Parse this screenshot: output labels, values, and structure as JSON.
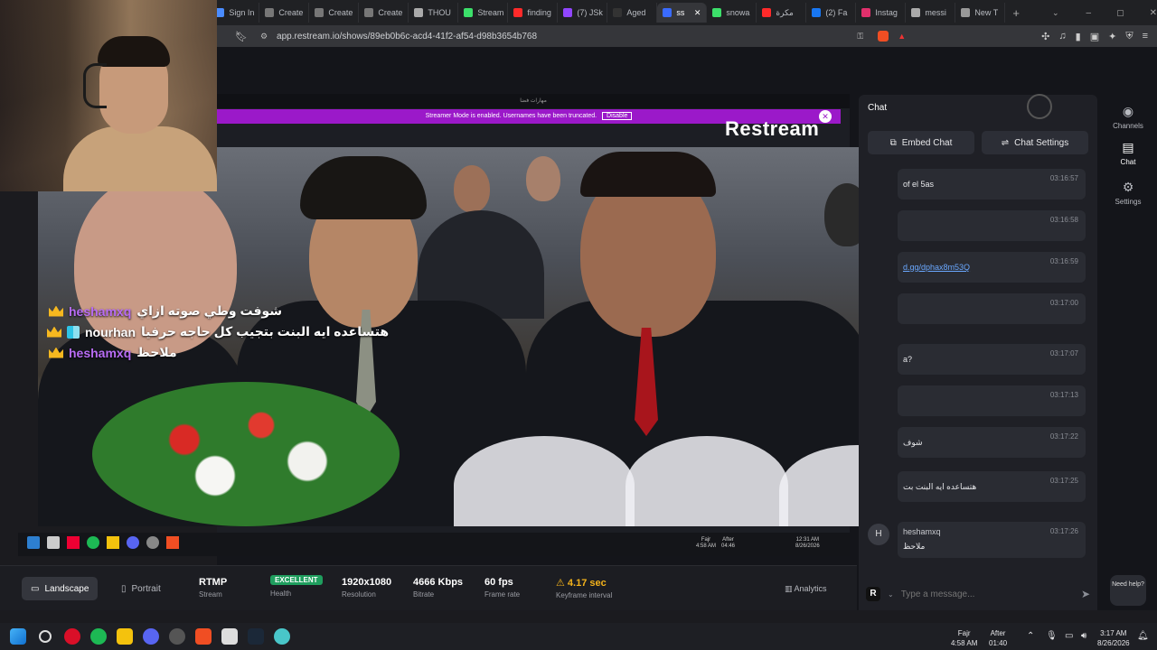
{
  "browser": {
    "tabs": [
      {
        "label": "Sign In",
        "color": "#4a8cff"
      },
      {
        "label": "Create",
        "color": "#777"
      },
      {
        "label": "Create",
        "color": "#777"
      },
      {
        "label": "Create",
        "color": "#777"
      },
      {
        "label": "THOU",
        "color": "#aaa"
      },
      {
        "label": "Stream",
        "color": "#3cdf6a"
      },
      {
        "label": "finding",
        "color": "#ff2a2a"
      },
      {
        "label": "(7) JSk",
        "color": "#9146ff"
      },
      {
        "label": "Aged",
        "color": "#333"
      },
      {
        "label": "ss",
        "color": "#3a6bff"
      },
      {
        "label": "snowa",
        "color": "#3cdf6a"
      },
      {
        "label": "مكرة",
        "color": "#ff2a2a"
      },
      {
        "label": "(2) Fa",
        "color": "#1877f2"
      },
      {
        "label": "Instag",
        "color": "#e1306c"
      },
      {
        "label": "messi",
        "color": "#aaa"
      },
      {
        "label": "New T",
        "color": "#999"
      }
    ],
    "url": "app.restream.io/shows/89eb0b6c-acd4-41f2-af54-d98b3654b768"
  },
  "inner": {
    "title": "مهارات فضا",
    "streamer_mode": "Streamer Mode is enabled. Usernames have been truncated.",
    "disable_label": "Disable",
    "logo": "Restream",
    "time": "12:31 AM",
    "date": "8/26/2026"
  },
  "overlay_chat": [
    {
      "user": "heshamxq",
      "message": "شوفت وطي صوته ازاي",
      "badge": "crown"
    },
    {
      "user": "nourhan",
      "message": "هتساعده ايه البنت بتجيب كل حاجه حرفيا",
      "badge": "crown2"
    },
    {
      "user": "heshamxq",
      "message": "ملاحظ",
      "badge": "crown"
    }
  ],
  "stats": {
    "landscape": "Landscape",
    "portrait": "Portrait",
    "protocol": {
      "value": "RTMP",
      "label": "Stream"
    },
    "health": {
      "value": "EXCELLENT",
      "label": "Health"
    },
    "resolution": {
      "value": "1920x1080",
      "label": "Resolution"
    },
    "bitrate": {
      "value": "4666 Kbps",
      "label": "Bitrate"
    },
    "framerate": {
      "value": "60 fps",
      "label": "Frame rate"
    },
    "keyframe": {
      "value": "4.17 sec",
      "label": "Keyframe interval"
    },
    "analytics": "Analytics"
  },
  "chat": {
    "title": "Chat",
    "embed": "Embed Chat",
    "settings": "Chat Settings",
    "messages": [
      {
        "time": "03:16:57",
        "user": "",
        "text": "of el 5as"
      },
      {
        "time": "03:16:58",
        "user": "",
        "text": ""
      },
      {
        "time": "03:16:59",
        "user": "",
        "text": "d.gg/dphax8m53Q"
      },
      {
        "time": "03:17:00",
        "user": "",
        "text": ""
      },
      {
        "time": "03:17:07",
        "user": "",
        "text": "a?"
      },
      {
        "time": "03:17:13",
        "user": "",
        "text": ""
      },
      {
        "time": "03:17:22",
        "user": "",
        "text": "شوف"
      },
      {
        "time": "03:17:25",
        "user": "",
        "text": "هتساعده ايه البنت بت"
      },
      {
        "time": "03:17:26",
        "user": "heshamxq",
        "text": "ملاحظ"
      }
    ],
    "input_placeholder": "Type a message...",
    "need_help": "Need help?"
  },
  "rail": {
    "channels": "Channels",
    "chat": "Chat",
    "settings": "Settings"
  },
  "taskbar": {
    "prayer": "Fajr",
    "prayer_time": "4:58 AM",
    "after_label": "After",
    "after_time": "01:40",
    "time": "3:17 AM",
    "date": "8/26/2026",
    "inner_prayer": "Fajr",
    "inner_prayer_time": "4:58 AM",
    "inner_after": "After",
    "inner_after_time": "04:46"
  }
}
